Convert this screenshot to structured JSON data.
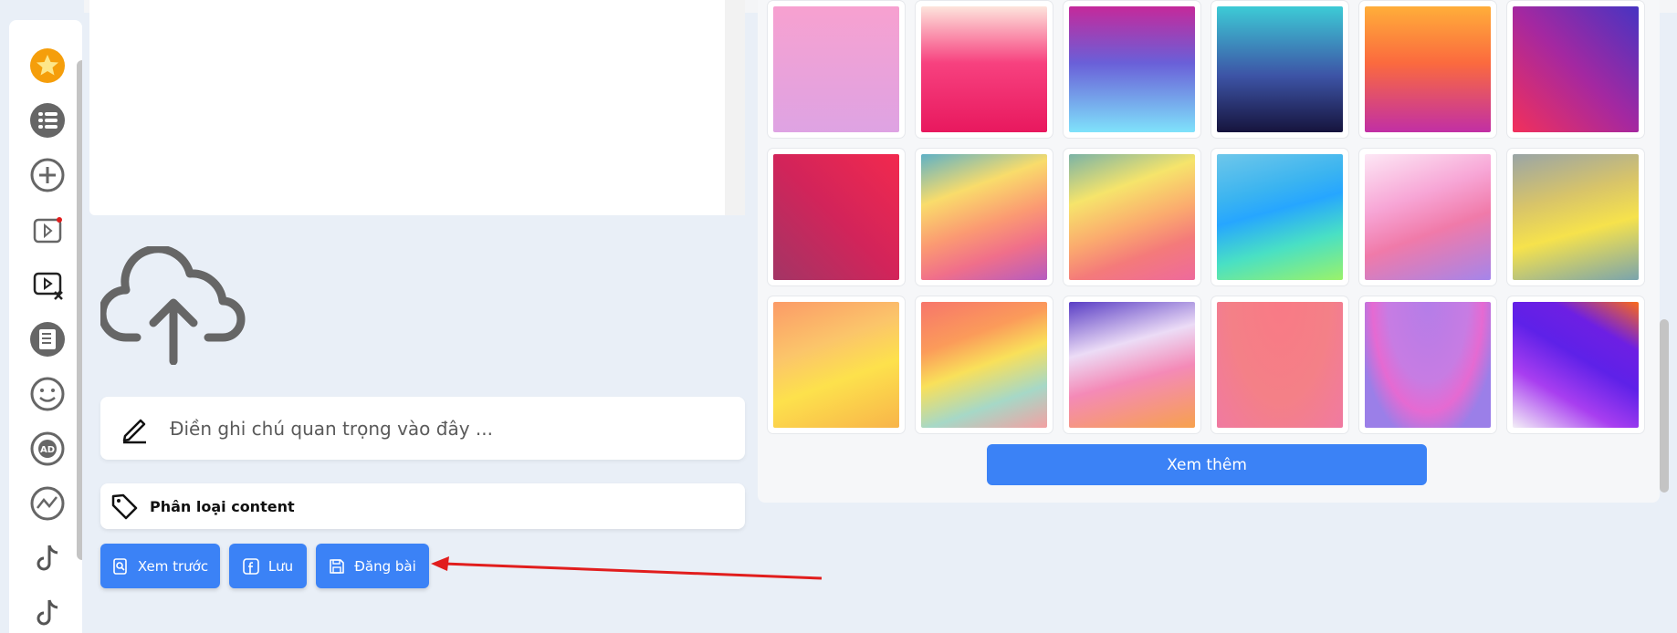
{
  "sidebar": {
    "icons": [
      "star-icon",
      "list-icon",
      "add-icon",
      "video-icon",
      "video-remove-icon",
      "document-icon",
      "smile-icon",
      "ad-icon",
      "analytics-icon",
      "tiktok-icon",
      "tiktok-icon-2"
    ]
  },
  "note": {
    "placeholder": "Điền ghi chú quan trọng vào đây ..."
  },
  "tag": {
    "label": "Phân loại content"
  },
  "actions": {
    "preview_label": "Xem trước",
    "save_label": "Lưu",
    "post_label": "Đăng bài"
  },
  "gallery": {
    "more_label": "Xem thêm"
  },
  "colors": {
    "accent": "#3b82f6",
    "annotation_arrow": "#e11d1d"
  }
}
